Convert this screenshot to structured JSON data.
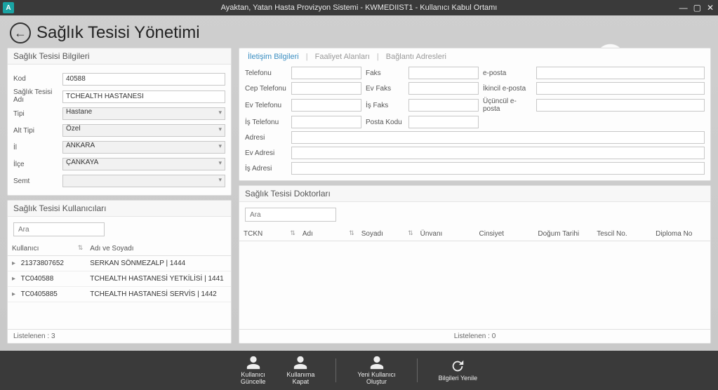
{
  "app": {
    "title": "Ayaktan, Yatan Hasta Provizyon Sistemi - KWMEDIIST1 - Kullanıcı Kabul Ortamı",
    "page_title": "Sağlık Tesisi Yönetimi",
    "logo_letter": "A"
  },
  "facility_panel": {
    "title": "Sağlık Tesisi Bilgileri",
    "labels": {
      "kod": "Kod",
      "adi": "Sağlık Tesisi Adı",
      "tipi": "Tipi",
      "alt_tipi": "Alt Tipi",
      "il": "İl",
      "ilce": "İlçe",
      "semt": "Semt"
    },
    "values": {
      "kod": "40588",
      "adi": "TCHEALTH HASTANESİ",
      "tipi": "Hastane",
      "alt_tipi": "Özel",
      "il": "ANKARA",
      "ilce": "ÇANKAYA",
      "semt": ""
    }
  },
  "contact_panel": {
    "tabs": {
      "iletisim": "İletişim Bilgileri",
      "faaliyet": "Faaliyet Alanları",
      "baglanti": "Bağlantı Adresleri"
    },
    "labels": {
      "telefonu": "Telefonu",
      "cep_telefonu": "Cep Telefonu",
      "ev_telefonu": "Ev Telefonu",
      "is_telefonu": "İş Telefonu",
      "faks": "Faks",
      "ev_faks": "Ev Faks",
      "is_faks": "İş Faks",
      "posta_kodu": "Posta Kodu",
      "eposta": "e-posta",
      "ikinci_eposta": "İkincil e-posta",
      "ucuncu_eposta": "Üçüncül e-posta",
      "adresi": "Adresi",
      "ev_adresi": "Ev Adresi",
      "is_adresi": "İş Adresi"
    }
  },
  "users_panel": {
    "title": "Sağlık Tesisi Kullanıcıları",
    "search_placeholder": "Ara",
    "columns": {
      "kullanici": "Kullanıcı",
      "adi_soyadi": "Adı ve Soyadı"
    },
    "rows": [
      {
        "kullanici": "21373807652",
        "adi_soyadi": "SERKAN SÖNMEZALP | 1444"
      },
      {
        "kullanici": "TC040588",
        "adi_soyadi": "TCHEALTH HASTANESİ YETKİLİSİ | 1441"
      },
      {
        "kullanici": "TC0405885",
        "adi_soyadi": "TCHEALTH HASTANESİ SERVİS | 1442"
      }
    ],
    "footer_label": "Listelenen :",
    "footer_count": "3"
  },
  "doctors_panel": {
    "title": "Sağlık Tesisi Doktorları",
    "search_placeholder": "Ara",
    "columns": {
      "tckn": "TCKN",
      "adi": "Adı",
      "soyadi": "Soyadı",
      "unvani": "Ünvanı",
      "cinsiyet": "Cinsiyet",
      "dogum_tarihi": "Doğum Tarihi",
      "tescil_no": "Tescil No.",
      "diploma_no": "Diploma No"
    },
    "footer_label": "Listelenen :",
    "footer_count": "0"
  },
  "actions": {
    "guncelle": "Kullanıcı\nGüncelle",
    "kapat": "Kullanıma\nKapat",
    "olustur": "Yeni Kullanıcı\nOluştur",
    "yenile": "Bilgileri Yenile"
  }
}
